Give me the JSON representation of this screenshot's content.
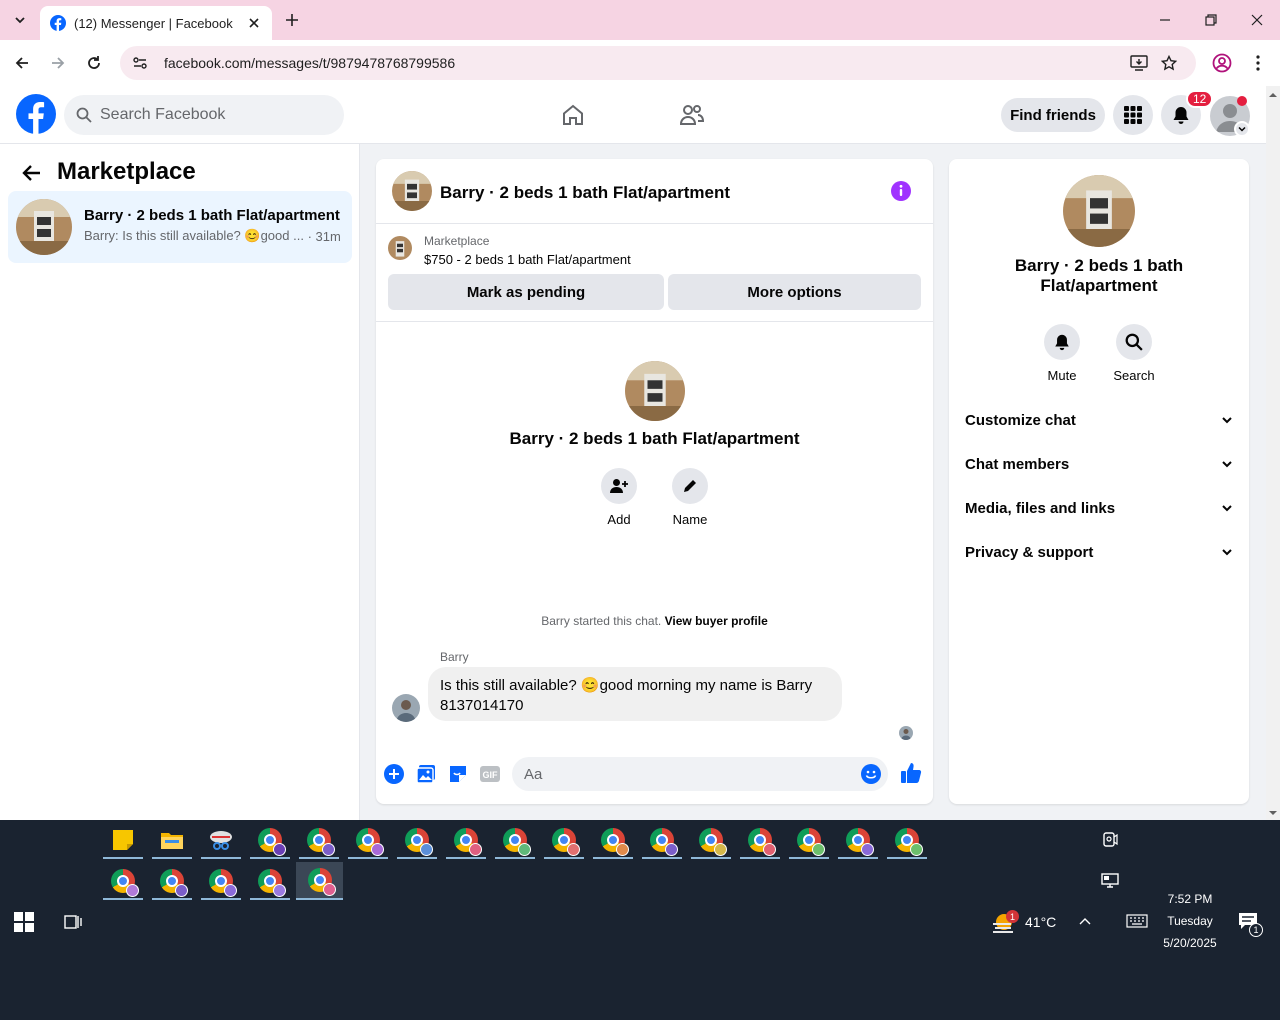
{
  "browser": {
    "tab_title": "(12) Messenger | Facebook",
    "url": "facebook.com/messages/t/9879478768799586"
  },
  "fb": {
    "search_placeholder": "Search Facebook",
    "find_friends": "Find friends",
    "notification_count": "12"
  },
  "sidebar": {
    "title": "Marketplace",
    "item": {
      "title": "Barry · 2 beds 1 bath Flat/apartment",
      "preview": "Barry: Is this still available? 😊good ...",
      "time": "· 31m"
    }
  },
  "chat": {
    "title": "Barry · 2 beds 1 bath Flat/apartment",
    "marketplace_label": "Marketplace",
    "listing": "$750 - 2 beds 1 bath Flat/apartment",
    "mark_pending": "Mark as pending",
    "more_options": "More options",
    "profile_name": "Barry · 2 beds 1 bath Flat/apartment",
    "add_label": "Add",
    "name_label": "Name",
    "started_text": "Barry started this chat.",
    "view_buyer": "View buyer profile",
    "sender": "Barry",
    "message": "Is this still available? 😊good morning my name is Barry 8137014170",
    "composer_placeholder": "Aa"
  },
  "panel": {
    "name": "Barry · 2 beds 1 bath Flat/apartment",
    "mute": "Mute",
    "search": "Search",
    "rows": [
      "Customize chat",
      "Chat members",
      "Media, files and links",
      "Privacy & support"
    ]
  },
  "taskbar": {
    "weather": "41°C",
    "weather_badge": "1",
    "time": "7:52 PM",
    "day": "Tuesday",
    "date": "5/20/2025",
    "notif_count": "1"
  },
  "colors": {
    "fb_blue": "#0866ff",
    "tab_strip": "#f6d4e3",
    "accent_purple": "#a033ff",
    "badge_red": "#e41e3f"
  }
}
